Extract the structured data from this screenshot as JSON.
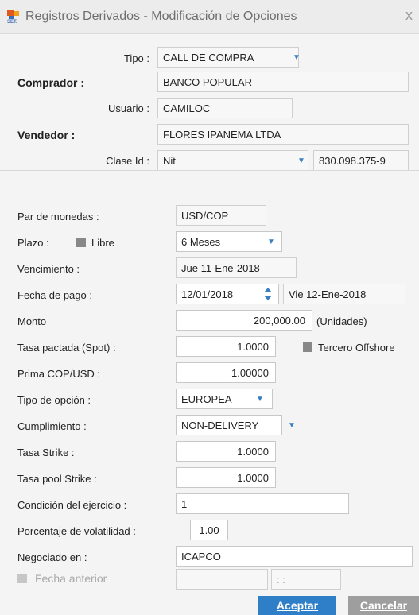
{
  "window": {
    "title": "Registros Derivados - Modificación de Opciones",
    "close_label": "x"
  },
  "header": {
    "tipo_label": "Tipo :",
    "tipo_value": "CALL DE COMPRA",
    "comprador_label": "Comprador :",
    "comprador_value": "BANCO POPULAR",
    "usuario_label": "Usuario :",
    "usuario_value": "CAMILOC",
    "vendedor_label": "Vendedor :",
    "vendedor_value": "FLORES IPANEMA LTDA",
    "clase_label": "Clase Id :",
    "clase_value": "Nit",
    "clase_id_number": "830.098.375-9"
  },
  "form": {
    "par_label": "Par de monedas :",
    "par_value": "USD/COP",
    "plazo_label": "Plazo :",
    "libre_label": "Libre",
    "plazo_value": "6 Meses",
    "vencimiento_label": "Vencimiento :",
    "vencimiento_value": "Jue  11-Ene-2018",
    "fecha_pago_label": "Fecha de pago :",
    "fecha_pago_value": "12/01/2018",
    "fecha_pago_text": "Vie  12-Ene-2018",
    "monto_label": "Monto",
    "monto_value": "200,000.00",
    "monto_unit": "(Unidades)",
    "tasa_spot_label": "Tasa pactada (Spot) :",
    "tasa_spot_value": "1.0000",
    "tercero_label": "Tercero Offshore",
    "prima_label": "Prima COP/USD :",
    "prima_value": "1.00000",
    "tipo_opcion_label": "Tipo de opción :",
    "tipo_opcion_value": "EUROPEA",
    "cumplimiento_label": "Cumplimiento :",
    "cumplimiento_value": "NON-DELIVERY",
    "strike_label": "Tasa Strike :",
    "strike_value": "1.0000",
    "pool_label": "Tasa pool Strike :",
    "pool_value": "1.0000",
    "condicion_label": "Condición del ejercicio :",
    "condicion_value": "1",
    "volatilidad_label": "Porcentaje de volatilidad :",
    "volatilidad_value": "1.00",
    "negociado_label": "Negociado en :",
    "negociado_value": "ICAPCO",
    "fecha_anterior_label": "Fecha anterior",
    "fecha_anterior_time": ": :"
  },
  "buttons": {
    "aceptar": "Aceptar",
    "cancelar": "Cancelar"
  },
  "colors": {
    "accent": "#2f7fc8",
    "cancel": "#9e9e9e"
  },
  "icons": {
    "app": "set-app-icon",
    "dropdown": "chevron-down-icon",
    "spinner": "spinner-icon"
  }
}
